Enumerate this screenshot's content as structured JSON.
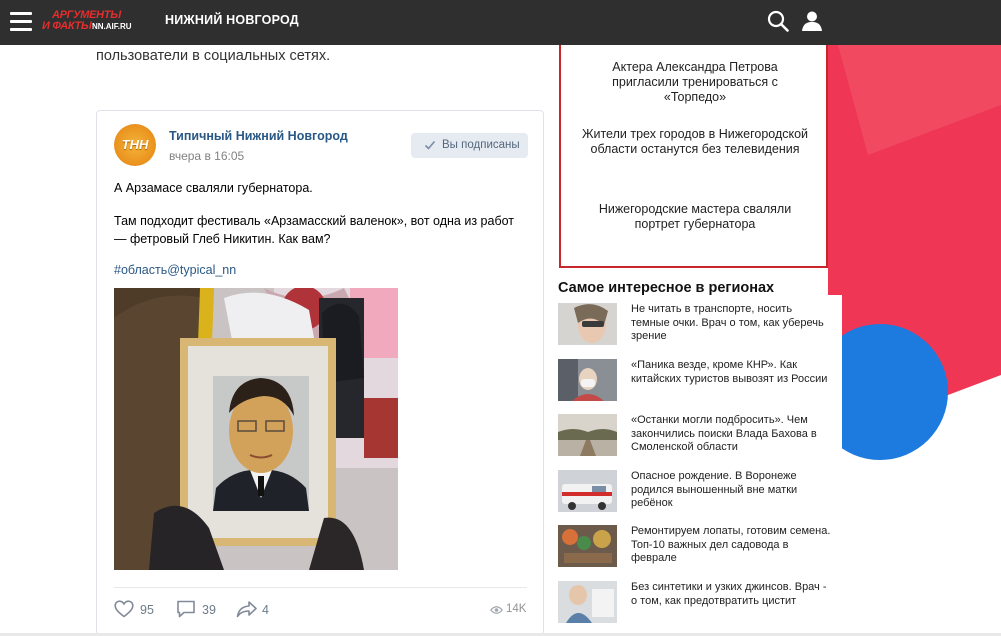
{
  "header": {
    "logo_line1": "АРГУМЕНТЫ",
    "logo_line2": "И ФАКТЫ",
    "logo_domain": "NN.AIF.RU",
    "city": "НИЖНИЙ НОВГОРОД",
    "icons": {
      "menu": "hamburger-menu-icon",
      "search": "search-icon",
      "user": "user-icon"
    },
    "colors": {
      "bar": "#2f2f2f",
      "brand": "#e52d2d"
    }
  },
  "article": {
    "lead_text": "пользователи в социальных сетях."
  },
  "post": {
    "author": "Типичный Нижний Новгород",
    "avatar_text": "ТНН",
    "time": "вчера в 16:05",
    "subscribe_label": "Вы подписаны",
    "text_line1": "А Арзамасе сваляли губернатора.",
    "text_line2": "Там подходит фестиваль «Арзамасский валенок», вот одна из работ — фетровый Глеб Никитин. Как вам?",
    "hashtag": "#область@typical_nn",
    "likes": "95",
    "comments": "39",
    "shares": "4",
    "views": "14K"
  },
  "sidebar_news": {
    "items": [
      {
        "text": "Актера Александра Петрова пригласили тренироваться с «Торпедо»"
      },
      {
        "text": "Жители трех городов в Нижегородской области останутся без телевидения"
      },
      {
        "text": "Нижегородские мастера сваляли портрет губернатора"
      }
    ],
    "border_color": "#c8262b"
  },
  "regions": {
    "title": "Самое интересное в регионах",
    "items": [
      {
        "text": "Не читать в транспорте, носить темные очки. Врач о том, как уберечь зрение"
      },
      {
        "text": "«Паника везде, кроме КНР». Как китайских туристов вывозят из России"
      },
      {
        "text": "«Останки могли подбросить». Чем закончились поиски Влада Бахова в Смоленской области"
      },
      {
        "text": "Опасное рождение. В Воронеже родился выношенный вне матки ребёнок"
      },
      {
        "text": "Ремонтируем лопаты, готовим семена. Топ-10 важных дел садовода в феврале"
      },
      {
        "text": "Без синтетики и узких джинсов. Врач - о том, как предотвратить цистит"
      }
    ]
  }
}
